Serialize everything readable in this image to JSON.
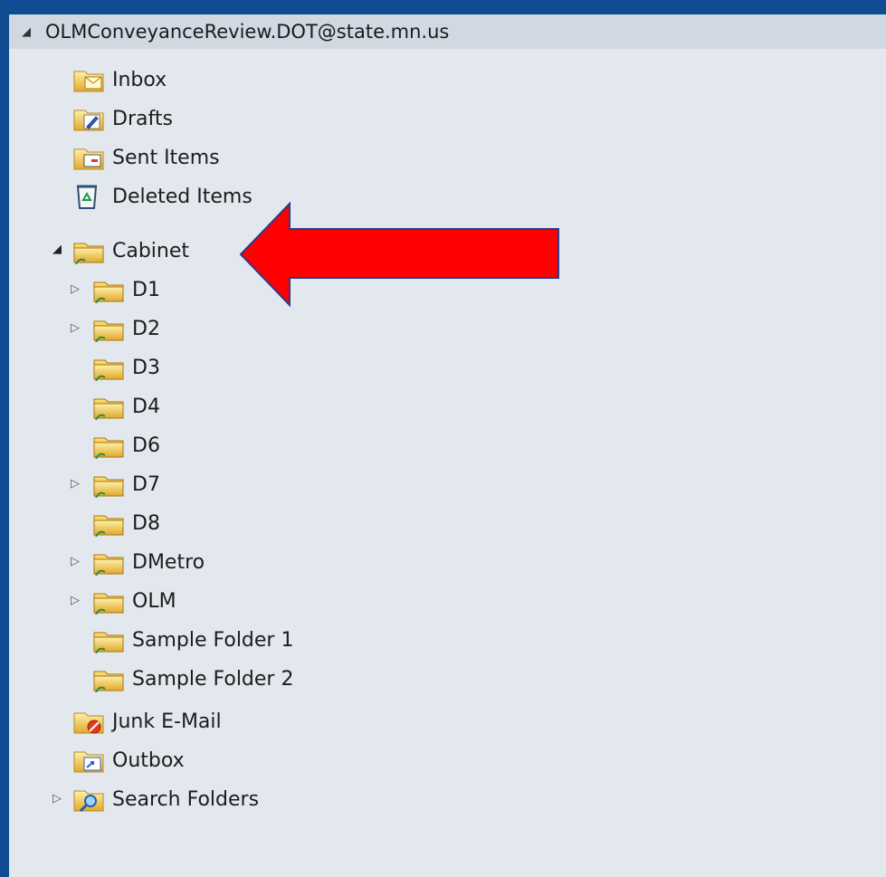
{
  "account": {
    "name": "OLMConveyanceReview.DOT@state.mn.us",
    "expanded": true
  },
  "folders": {
    "inbox": "Inbox",
    "drafts": "Drafts",
    "sent": "Sent Items",
    "deleted": "Deleted Items",
    "cabinet": "Cabinet",
    "d1": "D1",
    "d2": "D2",
    "d3": "D3",
    "d4": "D4",
    "d6": "D6",
    "d7": "D7",
    "d8": "D8",
    "dmetro": "DMetro",
    "olm": "OLM",
    "sample1": "Sample Folder 1",
    "sample2": "Sample Folder 2",
    "junk": "Junk E-Mail",
    "outbox": "Outbox",
    "search": "Search Folders"
  },
  "icons": {
    "mail_folder": "mail-folder-icon",
    "shared_folder": "shared-folder-icon",
    "deleted": "recycle-bin-icon",
    "junk": "junk-folder-icon",
    "outbox": "outbox-icon",
    "search": "search-folder-icon"
  },
  "colors": {
    "frame": "#0f4c91",
    "pane": "#e3e8ee",
    "header": "#d1d8e2",
    "annotation_arrow": "#ff0000"
  }
}
